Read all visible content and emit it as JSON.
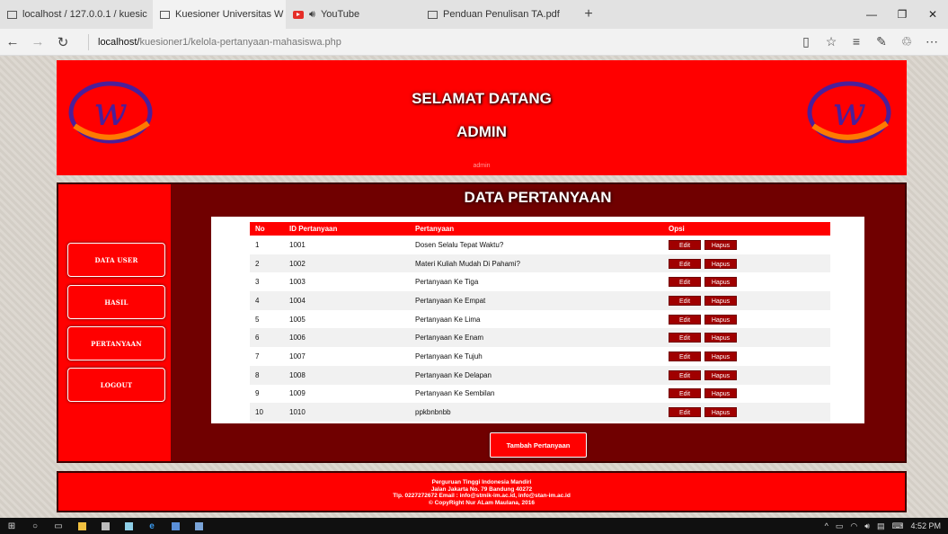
{
  "browser": {
    "tabs": [
      {
        "title": "localhost / 127.0.0.1 / kuesic",
        "active": false,
        "icon": "page-icon"
      },
      {
        "title": "Kuesioner Universitas W",
        "active": true,
        "icon": "page-icon"
      },
      {
        "title": "YouTube",
        "active": false,
        "icon": "youtube-icon"
      },
      {
        "title": "Penduan Penulisan TA.pdf",
        "active": false,
        "icon": "page-icon"
      }
    ],
    "url_host": "localhost/",
    "url_path": "kuesioner1/kelola-pertanyaan-mahasiswa.php"
  },
  "header": {
    "welcome_line1": "SELAMAT DATANG",
    "welcome_line2": "ADMIN",
    "user_small": "admin"
  },
  "sidebar": {
    "items": [
      {
        "label": "DATA USER"
      },
      {
        "label": "HASIL"
      },
      {
        "label": "PERTANYAAN"
      },
      {
        "label": "LOGOUT"
      }
    ]
  },
  "content": {
    "title": "DATA PERTANYAAN",
    "columns": [
      "No",
      "ID Pertanyaan",
      "Pertanyaan",
      "Opsi"
    ],
    "rows": [
      {
        "no": "1",
        "id": "1001",
        "text": "Dosen Selalu Tepat Waktu?"
      },
      {
        "no": "2",
        "id": "1002",
        "text": "Materi Kuliah Mudah Di Pahami?"
      },
      {
        "no": "3",
        "id": "1003",
        "text": "Pertanyaan Ke Tiga"
      },
      {
        "no": "4",
        "id": "1004",
        "text": "Pertanyaan Ke Empat"
      },
      {
        "no": "5",
        "id": "1005",
        "text": "Pertanyaan Ke Lima"
      },
      {
        "no": "6",
        "id": "1006",
        "text": "Pertanyaan Ke Enam"
      },
      {
        "no": "7",
        "id": "1007",
        "text": "Pertanyaan Ke Tujuh"
      },
      {
        "no": "8",
        "id": "1008",
        "text": "Pertanyaan Ke Delapan"
      },
      {
        "no": "9",
        "id": "1009",
        "text": "Pertanyaan Ke Sembilan"
      },
      {
        "no": "10",
        "id": "1010",
        "text": "ppkbnbnbb"
      }
    ],
    "edit_label": "Edit",
    "delete_label": "Hapus",
    "add_button": "Tambah Pertanyaan"
  },
  "footer": {
    "lines": [
      "Perguruan Tinggi Indonesia Mandiri",
      "Jalan Jakarta No. 79 Bandung 40272",
      "Tlp. 0227272672 Email : info@stmik-im.ac.id, info@stan-im.ac.id",
      "© CopyRight Nur ALam Maulana, 2016"
    ]
  },
  "taskbar": {
    "time": "4:52 PM"
  },
  "colors": {
    "brand_red": "#ff0000",
    "dark_red": "#700000",
    "button_red": "#a00000"
  }
}
